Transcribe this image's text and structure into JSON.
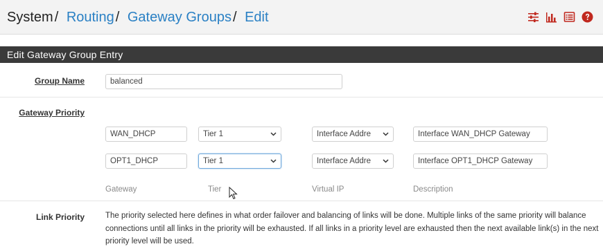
{
  "header": {
    "breadcrumb": {
      "system": "System",
      "routing": "Routing",
      "gateway_groups": "Gateway Groups",
      "edit": "Edit",
      "separator": "/"
    },
    "icons": [
      "sliders-icon",
      "bar-chart-icon",
      "list-icon",
      "help-icon"
    ],
    "icon_color": "#c0281e",
    "link_color": "#2a80c4"
  },
  "panel": {
    "title": "Edit Gateway Group Entry",
    "title_bg": "#3a3a3a"
  },
  "group_name": {
    "label": "Group Name",
    "value": "balanced"
  },
  "gateway_priority": {
    "label": "Gateway Priority",
    "rows": [
      {
        "gateway": "WAN_DHCP",
        "tier": "Tier 1",
        "virtual_ip": "Interface Addre",
        "description": "Interface WAN_DHCP Gateway"
      },
      {
        "gateway": "OPT1_DHCP",
        "tier": "Tier 1",
        "virtual_ip": "Interface Addre",
        "description": "Interface OPT1_DHCP Gateway"
      }
    ],
    "columns": {
      "gateway": "Gateway",
      "tier": "Tier",
      "virtual_ip": "Virtual IP",
      "description": "Description"
    }
  },
  "link_priority": {
    "label": "Link Priority",
    "help": "The priority selected here defines in what order failover and balancing of links will be done. Multiple links of the same priority will balance connections until all links in the priority will be exhausted. If all links in a priority level are exhausted then the next available link(s) in the next priority level will be used."
  }
}
